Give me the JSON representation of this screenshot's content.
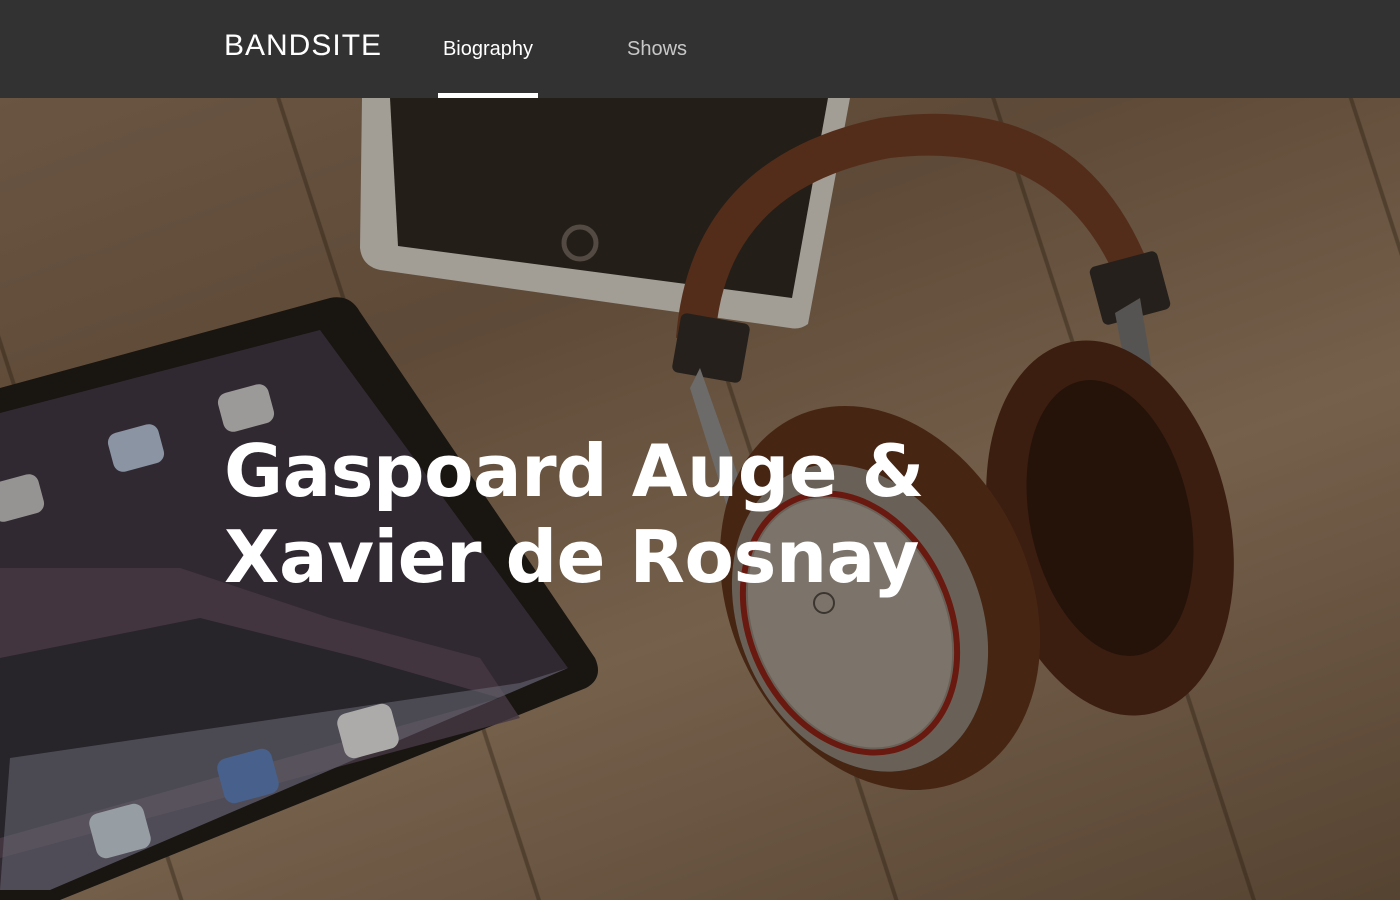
{
  "header": {
    "logo": "BANDSITE",
    "nav": [
      {
        "label": "Biography",
        "active": true
      },
      {
        "label": "Shows",
        "active": false
      }
    ]
  },
  "hero": {
    "title_line1": "Gaspoard Auge &",
    "title_line2": "Xavier de Rosnay",
    "image": "hero-headphones-tablet-photo"
  },
  "colors": {
    "header_bg": "#323232",
    "nav_active": "#ffffff",
    "nav_inactive": "#c8c8c8"
  }
}
